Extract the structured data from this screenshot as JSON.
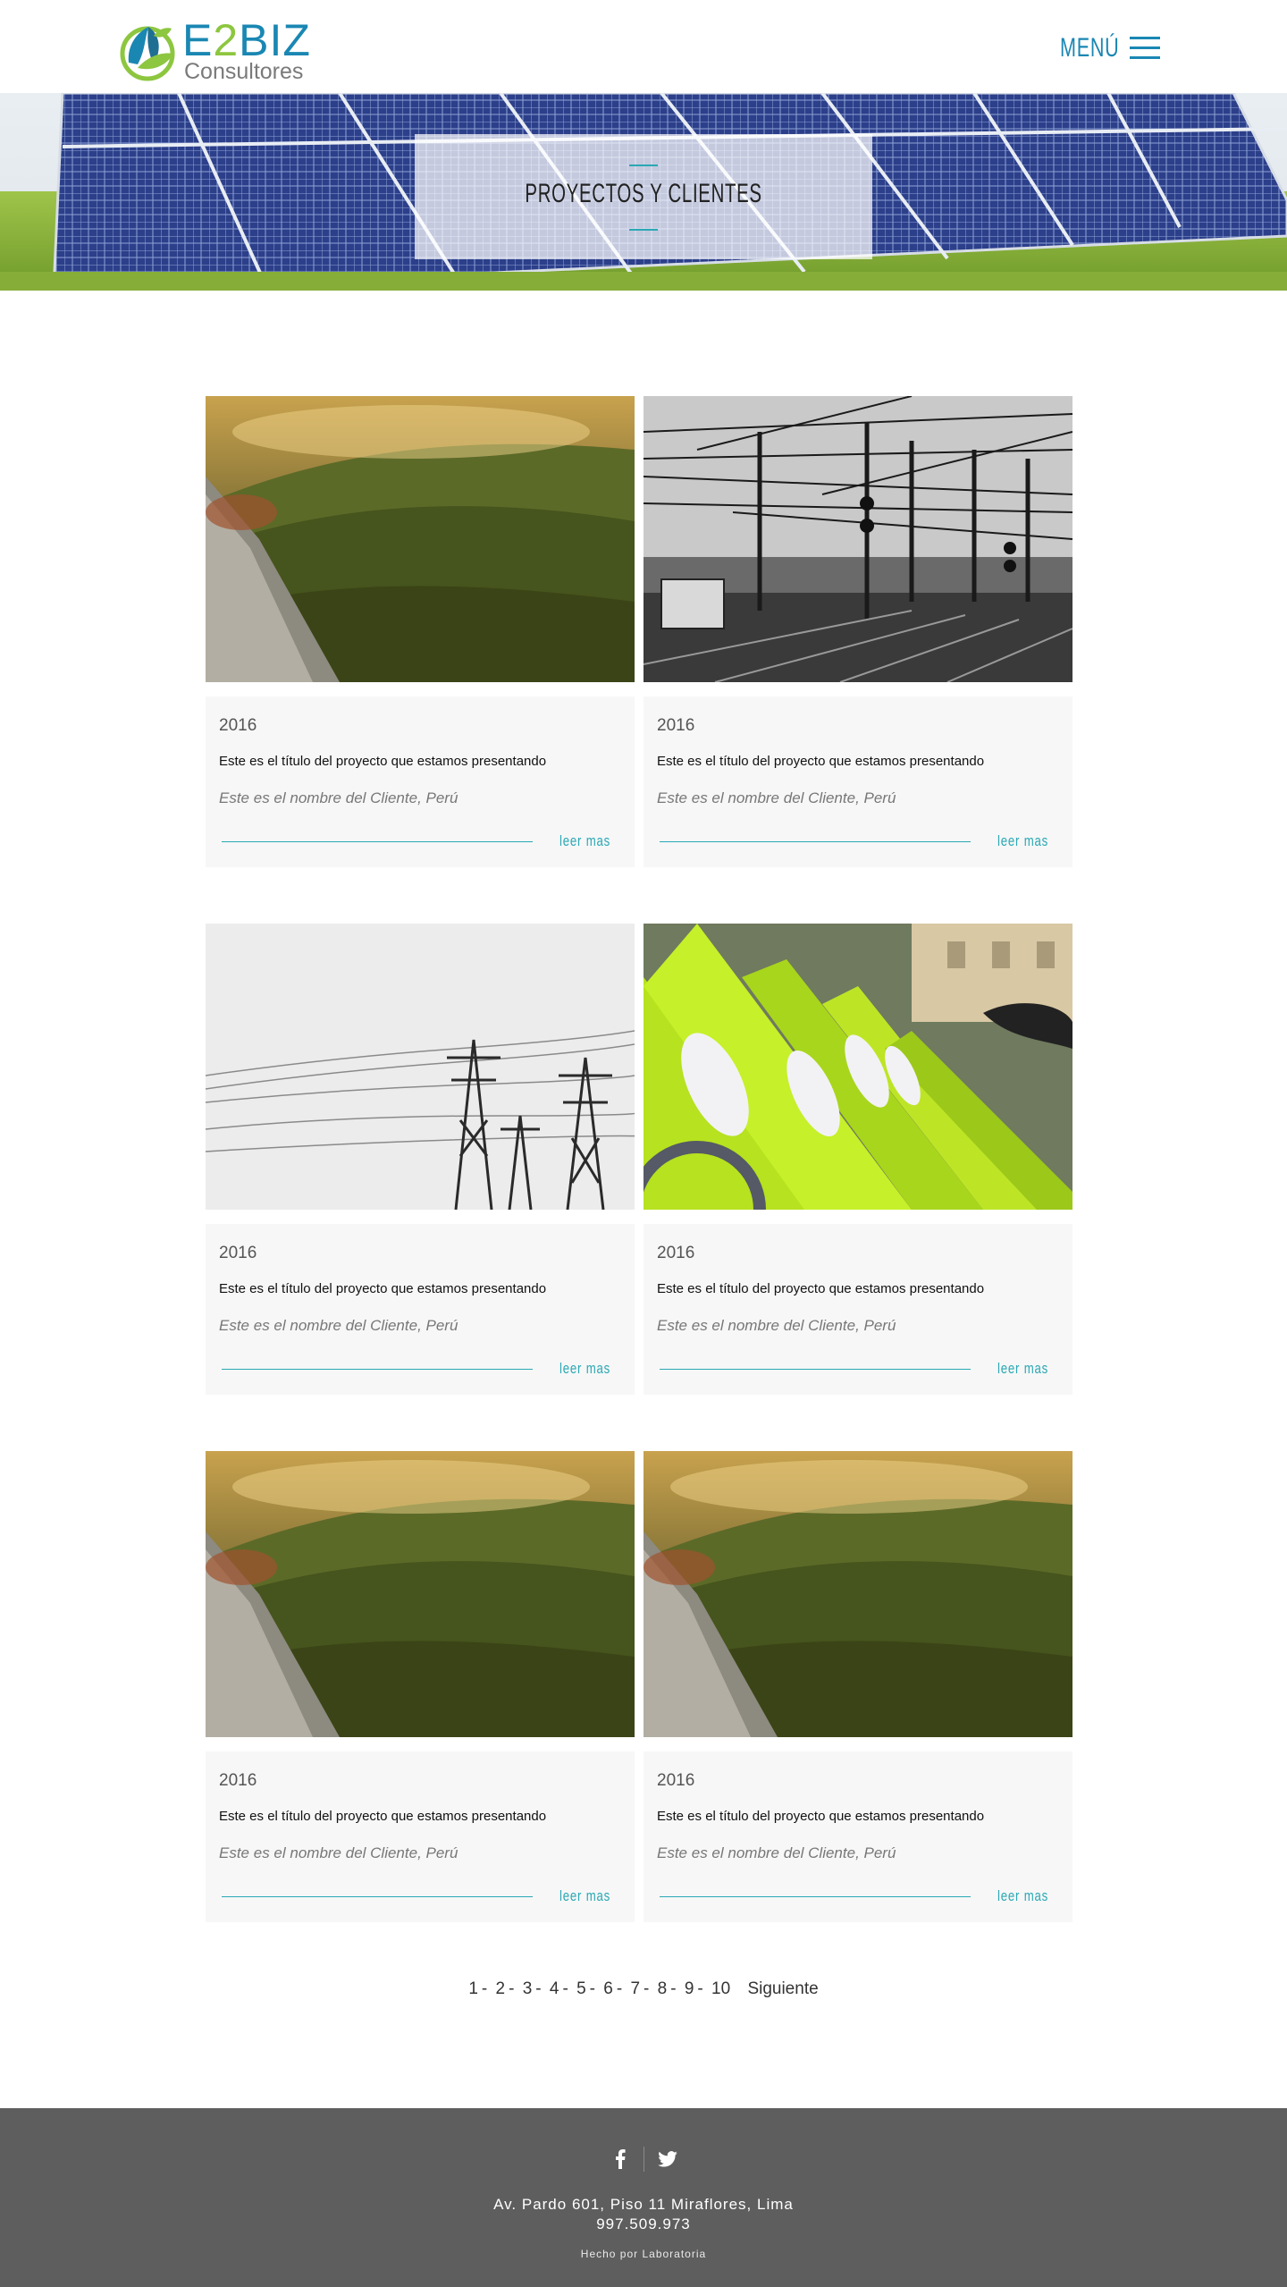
{
  "header": {
    "logo_brand_a": "E",
    "logo_brand_b": "2",
    "logo_brand_c": "BIZ",
    "logo_subtitle": "Consultores",
    "menu_label": "MENÚ"
  },
  "hero": {
    "title": "PROYECTOS Y CLIENTES"
  },
  "projects": [
    {
      "year": "2016",
      "title": "Este es el título del proyecto que estamos presentando",
      "client": "Este es el nombre del Cliente, Perú",
      "more": "leer mas",
      "image": "forest-valley"
    },
    {
      "year": "2016",
      "title": "Este es el título del proyecto que estamos presentando",
      "client": "Este es el nombre del Cliente, Perú",
      "more": "leer mas",
      "image": "railway-lines"
    },
    {
      "year": "2016",
      "title": "Este es el título del proyecto que estamos presentando",
      "client": "Este es el nombre del Cliente, Perú",
      "more": "leer mas",
      "image": "power-towers"
    },
    {
      "year": "2016",
      "title": "Este es el título del proyecto que estamos presentando",
      "client": "Este es el nombre del Cliente, Perú",
      "more": "leer mas",
      "image": "green-bikes"
    },
    {
      "year": "2016",
      "title": "Este es el título del proyecto que estamos presentando",
      "client": "Este es el nombre del Cliente, Perú",
      "more": "leer mas",
      "image": "forest-valley"
    },
    {
      "year": "2016",
      "title": "Este es el título del proyecto que estamos presentando",
      "client": "Este es el nombre del Cliente, Perú",
      "more": "leer mas",
      "image": "forest-valley"
    }
  ],
  "pagination": {
    "pages": [
      "1",
      "2",
      "3",
      "4",
      "5",
      "6",
      "7",
      "8",
      "9",
      "10"
    ],
    "separator": "-",
    "next": "Siguiente"
  },
  "footer": {
    "social_icons": [
      "facebook-icon",
      "twitter-icon"
    ],
    "address": "Av. Pardo 601, Piso 11 Miraflores, Lima",
    "phone": "997.509.973",
    "credit": "Hecho por Laboratoria"
  },
  "colors": {
    "brand_blue": "#1a87b3",
    "brand_green": "#8dc63f",
    "accent_teal": "#2aa8b4",
    "footer_bg": "#5e5e5e"
  }
}
